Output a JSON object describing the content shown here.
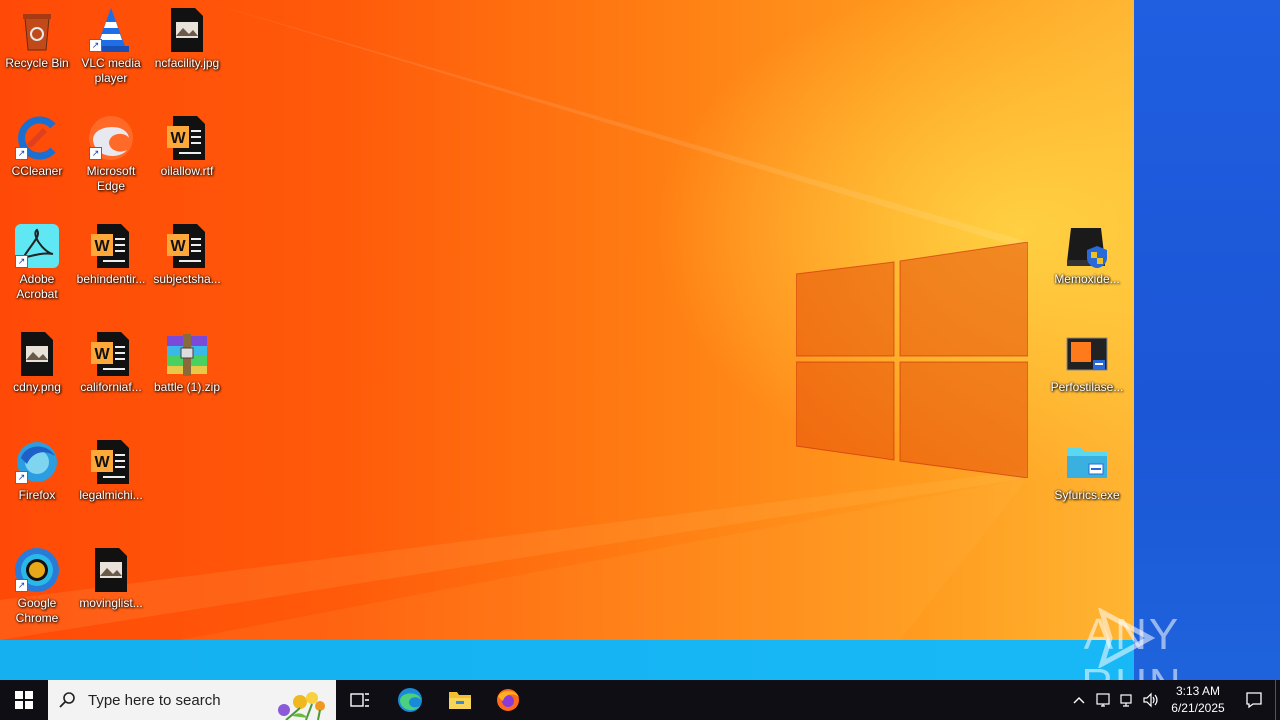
{
  "desktop": {
    "icons": [
      {
        "label": "Recycle Bin",
        "icon": "recycle-bin-icon"
      },
      {
        "label": "VLC media player",
        "icon": "vlc-icon"
      },
      {
        "label": "ncfacility.jpg",
        "icon": "image-file-icon"
      },
      {
        "label": "CCleaner",
        "icon": "ccleaner-icon"
      },
      {
        "label": "Microsoft Edge",
        "icon": "edge-icon"
      },
      {
        "label": "oilallow.rtf",
        "icon": "word-document-icon"
      },
      {
        "label": "Adobe Acrobat",
        "icon": "acrobat-icon"
      },
      {
        "label": "behindentir...",
        "icon": "word-document-icon"
      },
      {
        "label": "subjectsha...",
        "icon": "word-document-icon"
      },
      {
        "label": "cdny.png",
        "icon": "image-file-icon"
      },
      {
        "label": "californiaf...",
        "icon": "word-document-icon"
      },
      {
        "label": "battle (1).zip",
        "icon": "winrar-archive-icon"
      },
      {
        "label": "Firefox",
        "icon": "firefox-icon"
      },
      {
        "label": "legalmichi...",
        "icon": "word-document-icon"
      },
      {
        "label": "Google Chrome",
        "icon": "chrome-icon"
      },
      {
        "label": "movinglist...",
        "icon": "image-file-icon"
      },
      {
        "label": "Memoxide...",
        "icon": "drive-shield-icon"
      },
      {
        "label": "Perfostilase...",
        "icon": "installer-icon"
      },
      {
        "label": "Syfurics.exe",
        "icon": "exe-icon"
      }
    ],
    "watermark": "ANY RUN"
  },
  "taskbar": {
    "search_placeholder": "Type here to search",
    "pinned": [
      "task-view-icon",
      "edge-icon",
      "file-explorer-icon",
      "firefox-icon"
    ],
    "clock_time": "3:13 AM",
    "clock_date": "6/21/2025"
  },
  "colors": {
    "wallpaper_orange": "#ff5a0a",
    "wallpaper_blue": "#1b56d6",
    "taskbar": "#0e0e14"
  }
}
